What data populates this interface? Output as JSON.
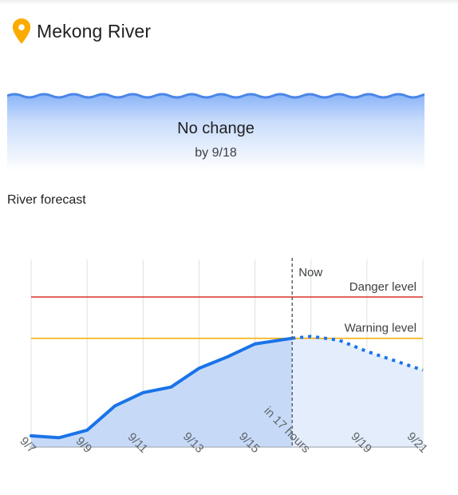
{
  "header": {
    "river_name": "Mekong River",
    "pin_icon": "location-pin-icon",
    "pin_color": "#F9AB00"
  },
  "status": {
    "title": "No change",
    "subtitle": "by 9/18"
  },
  "forecast": {
    "section_title": "River forecast"
  },
  "colors": {
    "danger": "#D93025",
    "warning": "#F9AB00",
    "line": "#1A73E8",
    "observed_fill": "#C6DAF8",
    "forecast_fill": "#E3EDFC"
  },
  "chart_data": {
    "type": "area",
    "x_tick_labels": [
      "9/7",
      "9/9",
      "9/11",
      "9/13",
      "9/15",
      "in 17 hours",
      "9/19",
      "9/21"
    ],
    "x_range": [
      7,
      21
    ],
    "now_x": 16.33,
    "now_label": "Now",
    "thresholds": [
      {
        "name": "Danger level",
        "value": 0.8
      },
      {
        "name": "Warning level",
        "value": 0.58
      }
    ],
    "y_range": [
      0,
      1
    ],
    "observed": {
      "x": [
        7,
        8,
        9,
        10,
        11,
        12,
        13,
        14,
        15,
        16.33
      ],
      "y": [
        0.06,
        0.05,
        0.09,
        0.22,
        0.29,
        0.32,
        0.42,
        0.48,
        0.55,
        0.58
      ]
    },
    "forecast": {
      "x": [
        16.33,
        17,
        18,
        19,
        20,
        21
      ],
      "y": [
        0.58,
        0.59,
        0.57,
        0.51,
        0.46,
        0.41
      ]
    },
    "grid": true,
    "legend": "none"
  }
}
